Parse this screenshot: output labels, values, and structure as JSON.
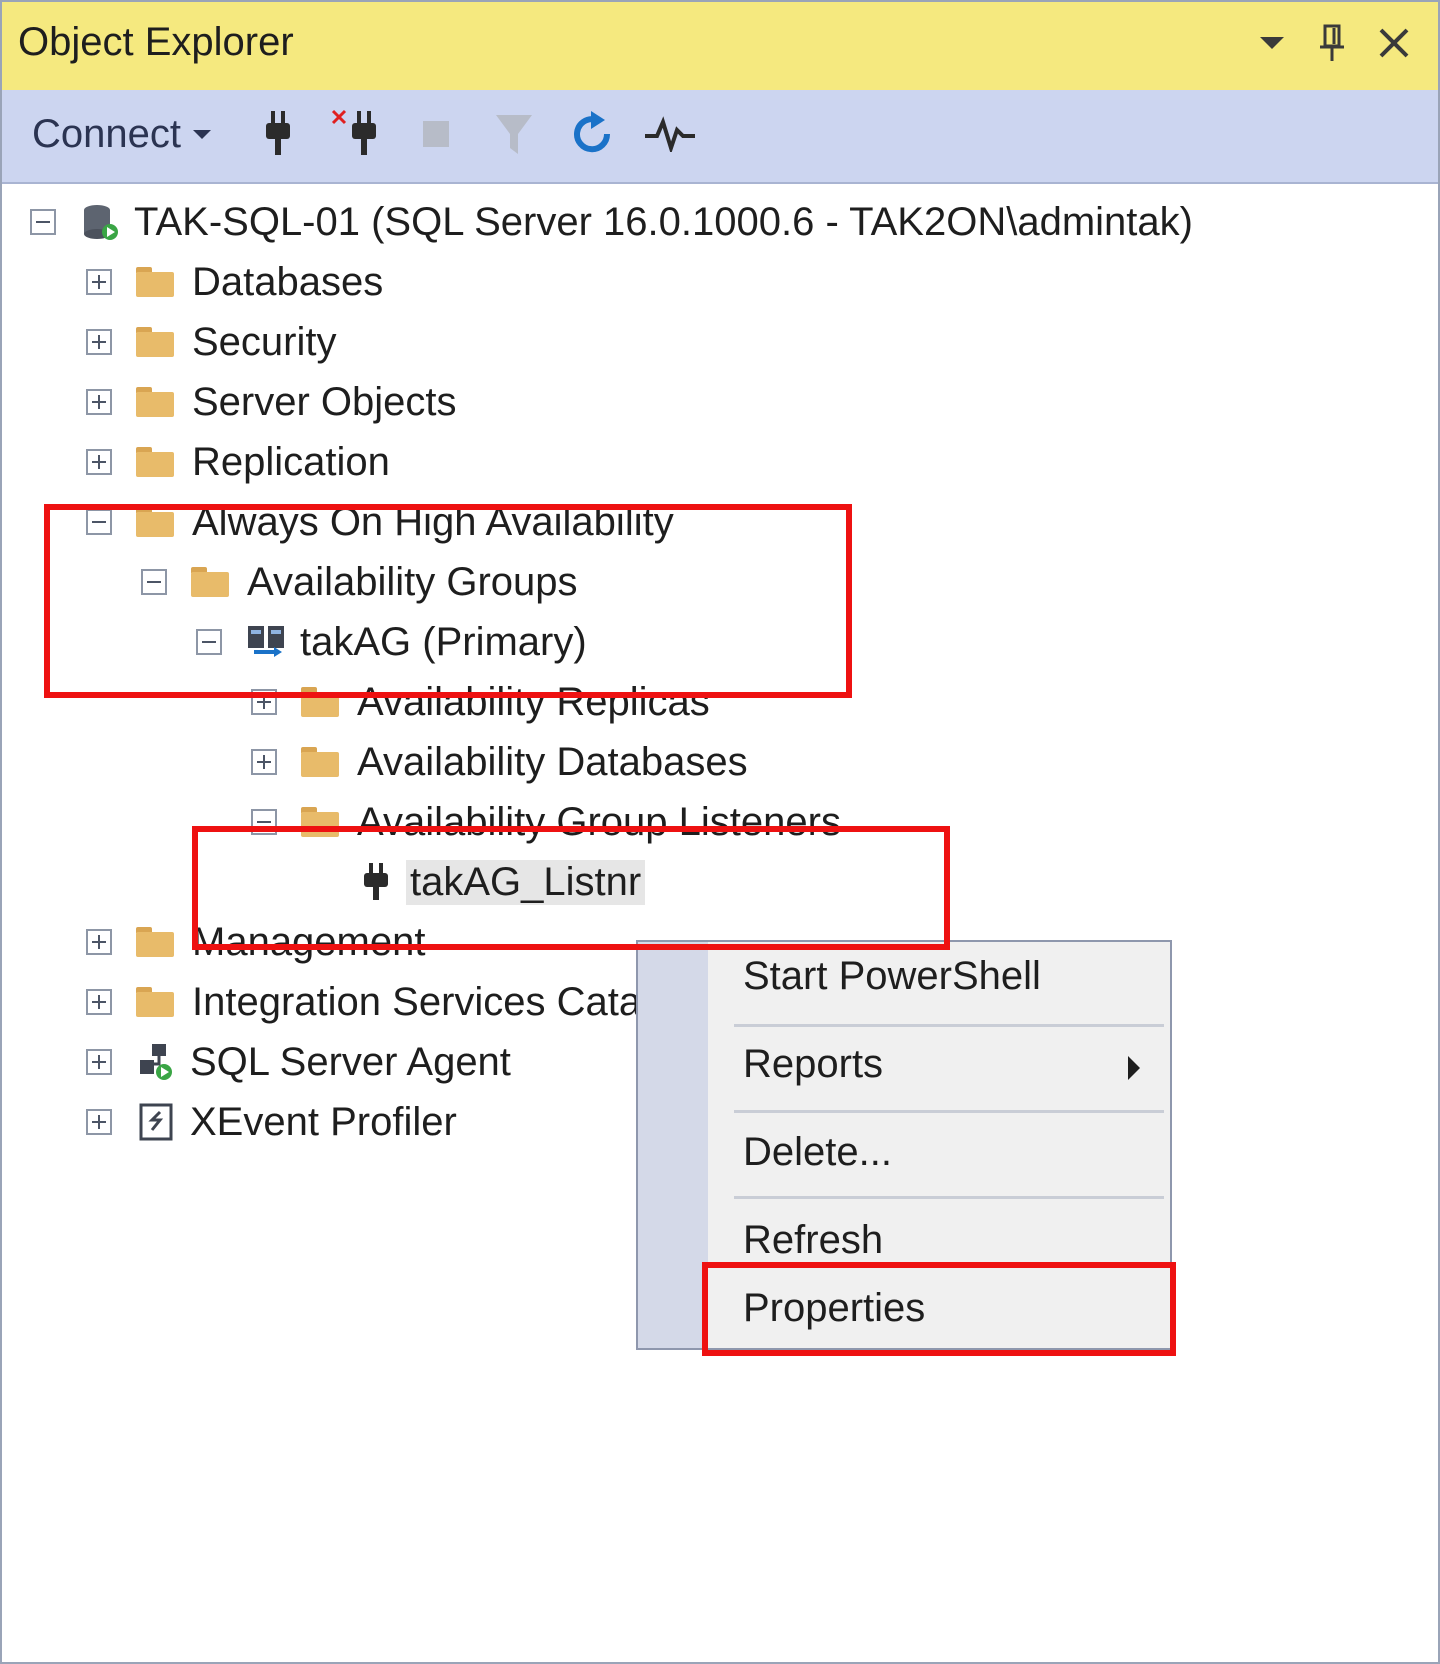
{
  "window": {
    "title": "Object Explorer"
  },
  "toolbar": {
    "connect_label": "Connect",
    "icons": [
      "connect-plug-icon",
      "disconnect-icon",
      "stop-icon",
      "filter-icon",
      "refresh-icon",
      "activity-monitor-icon"
    ]
  },
  "tree": {
    "server": "TAK-SQL-01 (SQL Server 16.0.1000.6 - TAK2ON\\admintak)",
    "databases": "Databases",
    "security": "Security",
    "server_objects": "Server Objects",
    "replication": "Replication",
    "always_on": "Always On High Availability",
    "availability_groups": "Availability Groups",
    "ag": "takAG (Primary)",
    "replicas": "Availability Replicas",
    "ag_databases": "Availability Databases",
    "listeners": "Availability Group Listeners",
    "listener": "takAG_Listnr",
    "management": "Management",
    "integration": "Integration Services Catalogs",
    "agent": "SQL Server Agent",
    "xevent": "XEvent Profiler"
  },
  "context_menu": {
    "items": [
      "Start PowerShell",
      "Reports",
      "Delete...",
      "Refresh",
      "Properties"
    ]
  },
  "colors": {
    "title_bar": "#f5e97f",
    "toolbar": "#ccd5f0",
    "highlight": "#ee1111",
    "folder": "#e8bb6a"
  }
}
